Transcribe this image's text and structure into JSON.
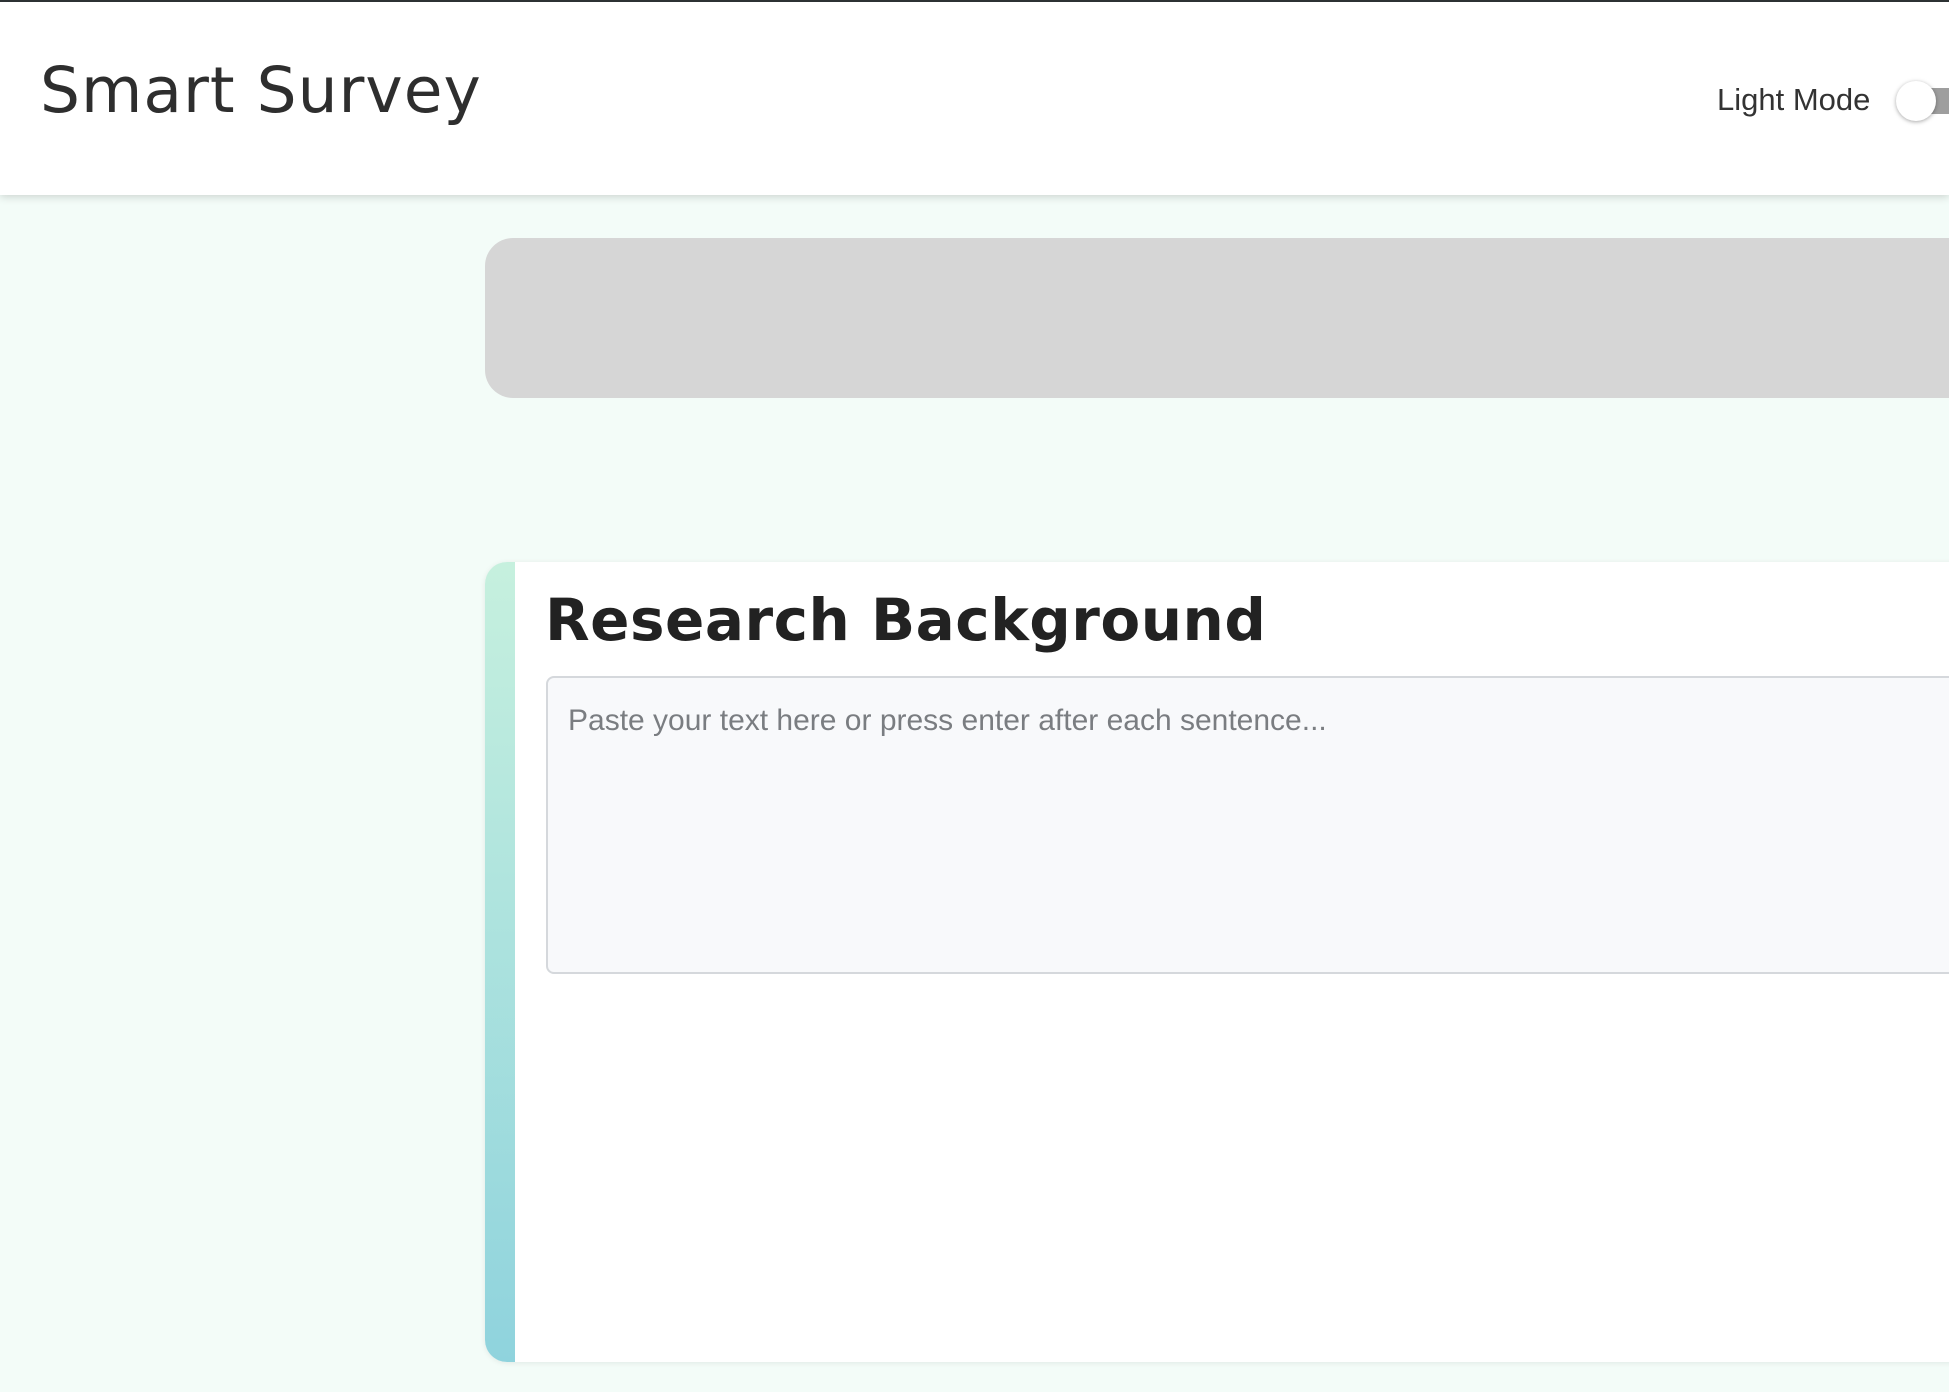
{
  "header": {
    "app_title": "Smart Survey",
    "mode_label": "Light Mode",
    "mode_toggle_on": false
  },
  "research_background": {
    "title": "Research Background",
    "input_value": "",
    "input_placeholder": "Paste your text here or press enter after each sentence..."
  },
  "colors": {
    "page_background": "#f3fcf8",
    "banner_gray": "#d6d6d6",
    "accent_gradient_top": "#c6f0de",
    "accent_gradient_bottom": "#8fd3dd",
    "toggle_track": "#9e9e9e"
  }
}
